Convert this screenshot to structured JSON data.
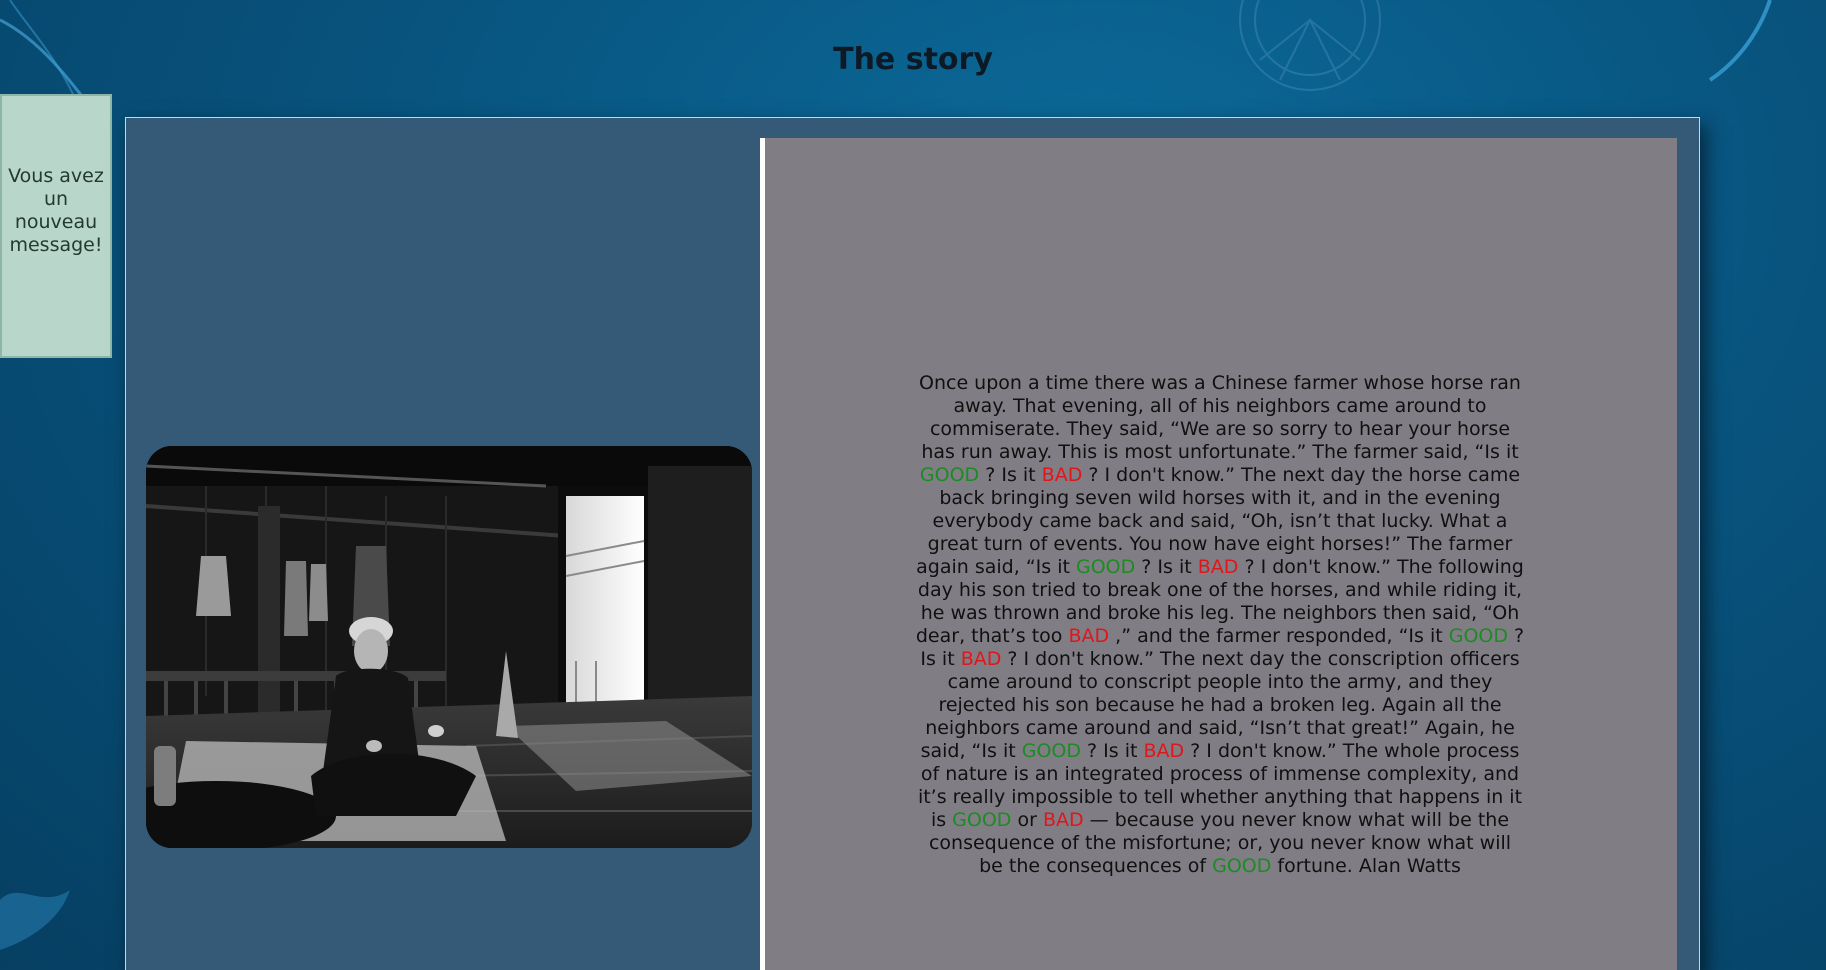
{
  "page": {
    "title": "The story"
  },
  "notification": {
    "text": "Vous avez un nouveau message!"
  },
  "photo": {
    "alt": "Black and white photo of an old man sitting cross-legged on the floor of a wooden house"
  },
  "story": {
    "segments": [
      {
        "type": "text",
        "text": "Once upon a time there was a Chinese farmer whose horse ran away. That evening, all of his neighbors came around to commiserate. They said, “We are so sorry to hear your horse has run away. This is most unfortunate.” The farmer said, “Is it "
      },
      {
        "type": "good",
        "text": "GOOD"
      },
      {
        "type": "text",
        "text": " ? Is it "
      },
      {
        "type": "bad",
        "text": "BAD"
      },
      {
        "type": "text",
        "text": " ? I don't know.” The next day the horse came back bringing seven wild horses with it, and in the evening everybody came back and said, “Oh, isn’t that lucky. What a great turn of events. You now have eight horses!” The farmer again said, “Is it "
      },
      {
        "type": "good",
        "text": "GOOD"
      },
      {
        "type": "text",
        "text": " ? Is it "
      },
      {
        "type": "bad",
        "text": "BAD"
      },
      {
        "type": "text",
        "text": " ? I don't know.” The following day his son tried to break one of the horses, and while riding it, he was thrown and broke his leg. The neighbors then said, “Oh dear, that’s too "
      },
      {
        "type": "bad",
        "text": "BAD"
      },
      {
        "type": "text",
        "text": " ,” and the farmer responded, “Is it "
      },
      {
        "type": "good",
        "text": "GOOD"
      },
      {
        "type": "text",
        "text": " ? Is it "
      },
      {
        "type": "bad",
        "text": "BAD"
      },
      {
        "type": "text",
        "text": " ? I don't know.” The next day the conscription officers came around to conscript people into the army, and they rejected his son because he had a broken leg. Again all the neighbors came around and said, “Isn’t that great!” Again, he said, “Is it "
      },
      {
        "type": "good",
        "text": "GOOD"
      },
      {
        "type": "text",
        "text": " ? Is it "
      },
      {
        "type": "bad",
        "text": "BAD"
      },
      {
        "type": "text",
        "text": " ? I don't know.” The whole process of nature is an integrated process of immense complexity, and it’s really impossible to tell whether anything that happens in it is "
      },
      {
        "type": "good",
        "text": "GOOD"
      },
      {
        "type": "text",
        "text": " or "
      },
      {
        "type": "bad",
        "text": "BAD"
      },
      {
        "type": "text",
        "text": " — because you never know what will be the consequence of the misfortune; or, you never know what will be the consequences of "
      },
      {
        "type": "good",
        "text": "GOOD"
      },
      {
        "type": "text",
        "text": " fortune. Alan Watts"
      }
    ]
  },
  "colors": {
    "good": "#1d8b24",
    "bad": "#e0161b",
    "background": "#08547f",
    "panel": "#355a78",
    "story_box": "#807e84",
    "notification_bg": "#b9d6cb"
  }
}
